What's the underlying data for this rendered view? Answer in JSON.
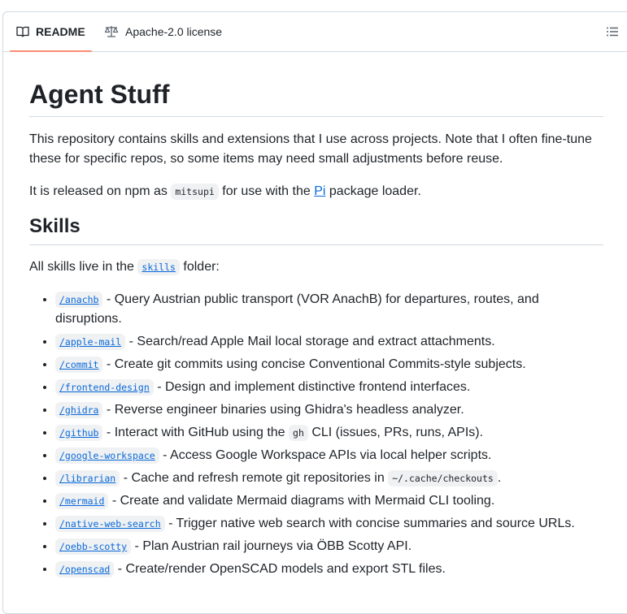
{
  "tabs": {
    "readme_label": "README",
    "license_label": "Apache-2.0 license"
  },
  "readme": {
    "title": "Agent Stuff",
    "intro": "This repository contains skills and extensions that I use across projects. Note that I often fine-tune these for specific repos, so some items may need small adjustments before reuse.",
    "release": {
      "prefix": "It is released on npm as",
      "package_code": "mitsupi",
      "middle": "for use with the",
      "link_text": "Pi",
      "suffix": "package loader."
    },
    "skills_heading": "Skills",
    "skills_intro": {
      "prefix": "All skills live in the",
      "folder_link": "skills",
      "suffix": "folder:"
    },
    "skills": [
      {
        "name": "/anachb",
        "desc": " - Query Austrian public transport (VOR AnachB) for departures, routes, and disruptions."
      },
      {
        "name": "/apple-mail",
        "desc": " - Search/read Apple Mail local storage and extract attachments."
      },
      {
        "name": "/commit",
        "desc": " - Create git commits using concise Conventional Commits-style subjects."
      },
      {
        "name": "/frontend-design",
        "desc": " - Design and implement distinctive frontend interfaces."
      },
      {
        "name": "/ghidra",
        "desc": " - Reverse engineer binaries using Ghidra's headless analyzer."
      },
      {
        "name": "/github",
        "desc_before": " - Interact with GitHub using the ",
        "code": "gh",
        "desc_after": " CLI (issues, PRs, runs, APIs)."
      },
      {
        "name": "/google-workspace",
        "desc": " - Access Google Workspace APIs via local helper scripts."
      },
      {
        "name": "/librarian",
        "desc_before": " - Cache and refresh remote git repositories in ",
        "code": "~/.cache/checkouts",
        "desc_after": "."
      },
      {
        "name": "/mermaid",
        "desc": " - Create and validate Mermaid diagrams with Mermaid CLI tooling."
      },
      {
        "name": "/native-web-search",
        "desc": " - Trigger native web search with concise summaries and source URLs."
      },
      {
        "name": "/oebb-scotty",
        "desc": " - Plan Austrian rail journeys via ÖBB Scotty API."
      },
      {
        "name": "/openscad",
        "desc": " - Create/render OpenSCAD models and export STL files."
      }
    ]
  }
}
